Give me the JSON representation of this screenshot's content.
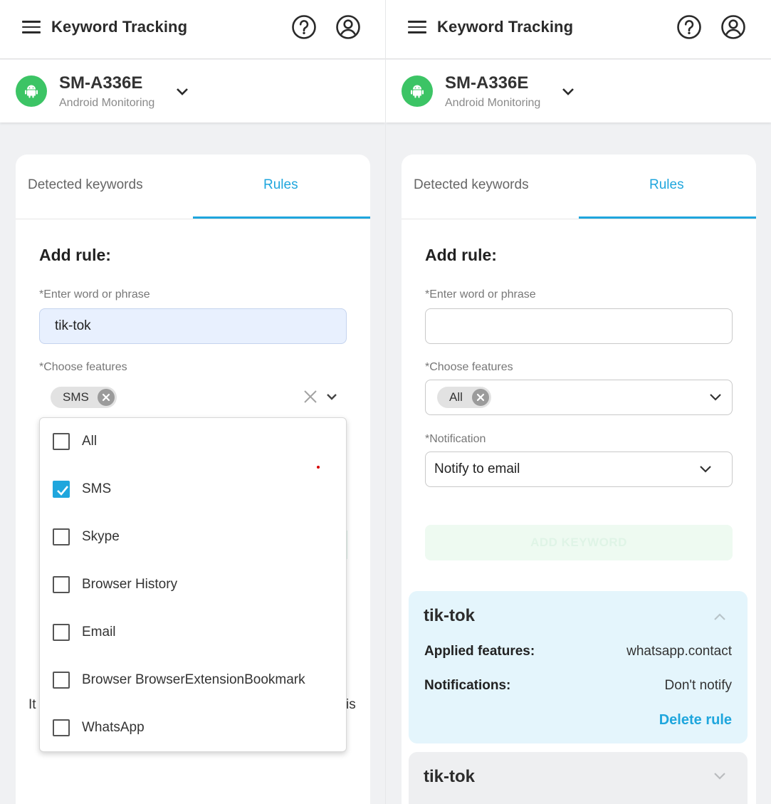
{
  "left": {
    "header": {
      "title": "Keyword Tracking"
    },
    "device": {
      "name": "SM-A336E",
      "subtitle": "Android Monitoring"
    },
    "tabs": [
      {
        "label": "Detected keywords"
      },
      {
        "label": "Rules"
      }
    ],
    "form": {
      "heading": "Add rule:",
      "word_label": "*Enter word or phrase",
      "word_value": "tik-tok",
      "features_label": "*Choose features",
      "selected_chip": "SMS"
    },
    "dropdown": {
      "options": [
        {
          "label": "All",
          "checked": false
        },
        {
          "label": "SMS",
          "checked": true
        },
        {
          "label": "Skype",
          "checked": false
        },
        {
          "label": "Browser History",
          "checked": false
        },
        {
          "label": "Email",
          "checked": false
        },
        {
          "label": "Browser BrowserExtensionBookmark",
          "checked": false
        },
        {
          "label": "WhatsApp",
          "checked": false
        }
      ]
    },
    "background_text": {
      "left_stub": "It",
      "right_stub": "is"
    }
  },
  "right": {
    "header": {
      "title": "Keyword Tracking"
    },
    "device": {
      "name": "SM-A336E",
      "subtitle": "Android Monitoring"
    },
    "tabs": [
      {
        "label": "Detected keywords"
      },
      {
        "label": "Rules"
      }
    ],
    "form": {
      "heading": "Add rule:",
      "word_label": "*Enter word or phrase",
      "word_value": "",
      "features_label": "*Choose features",
      "selected_chip": "All",
      "notification_label": "*Notification",
      "notification_value": "Notify to email",
      "add_button": "ADD KEYWORD"
    },
    "rules": [
      {
        "title": "tik-tok",
        "expanded": true,
        "features_label": "Applied features:",
        "features_value": "whatsapp.contact",
        "notifications_label": "Notifications:",
        "notifications_value": "Don't notify",
        "delete_label": "Delete rule"
      },
      {
        "title": "tik-tok",
        "expanded": false
      }
    ]
  },
  "colors": {
    "accent": "#1fa6dd",
    "android": "#3cc465",
    "rule_expanded_bg": "#e4f5fc"
  },
  "icons": [
    "menu-icon",
    "help-icon",
    "account-icon",
    "android-icon",
    "chevron-down-icon",
    "close-icon",
    "check-icon",
    "chevron-up-icon"
  ]
}
